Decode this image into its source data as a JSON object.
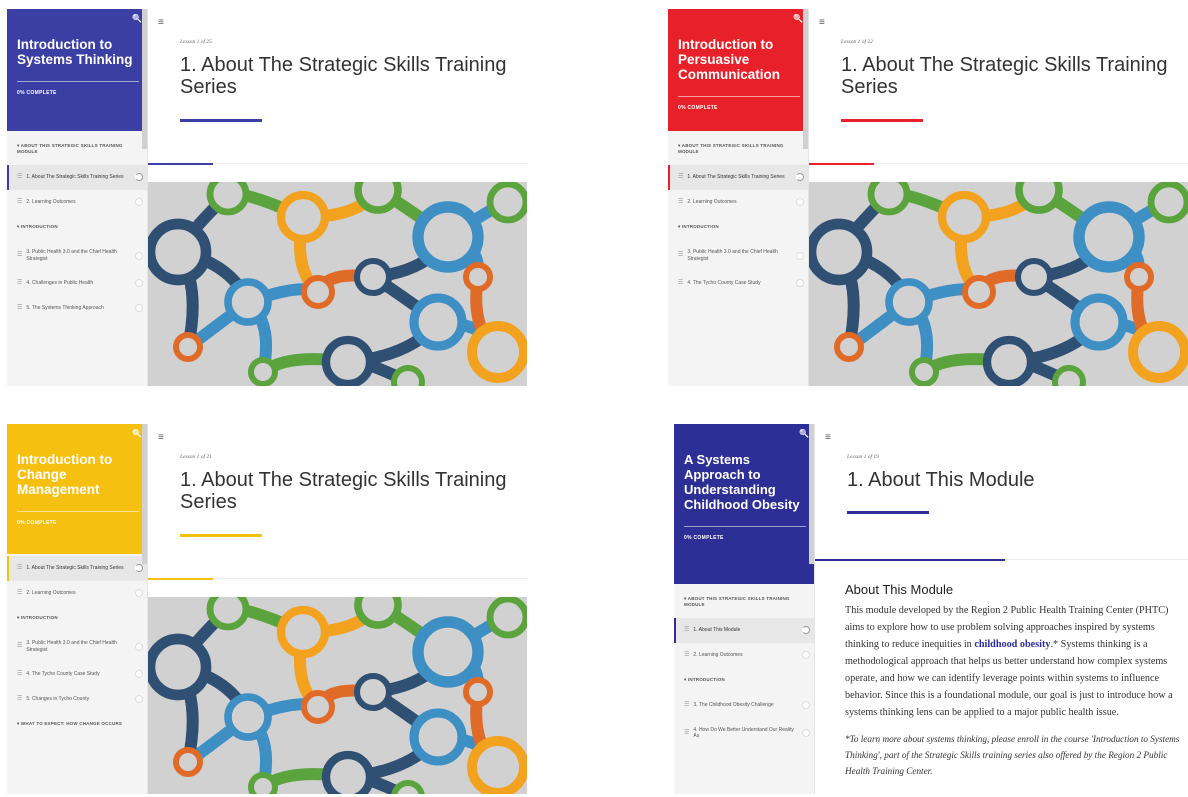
{
  "panels": [
    {
      "accent": "#3b3fa4",
      "course_title": "Introduction to Systems Thinking",
      "complete_label": "0% COMPLETE",
      "sections": [
        {
          "label": "ABOUT THIS STRATEGIC SKILLS TRAINING MODULE",
          "items": [
            {
              "label": "1. About The Strategic Skills Training Series",
              "active": true
            },
            {
              "label": "2. Learning Outcomes",
              "active": false
            }
          ]
        },
        {
          "label": "INTRODUCTION",
          "items": [
            {
              "label": "3. Public Health 3.0 and the Chief Health Strategist",
              "active": false
            },
            {
              "label": "4. Challenges in Public Health",
              "active": false
            },
            {
              "label": "5. The Systems Thinking Approach",
              "active": false
            }
          ]
        }
      ],
      "lesson_number": "Lesson 1 of 25",
      "lesson_title": "1. About The Strategic Skills Training Series"
    },
    {
      "accent": "#e8202a",
      "course_title": "Introduction to Persuasive Communication",
      "complete_label": "0% COMPLETE",
      "sections": [
        {
          "label": "ABOUT THIS STRATEGIC SKILLS TRAINING MODULE",
          "items": [
            {
              "label": "1. About The Strategic Skills Training Series",
              "active": true
            },
            {
              "label": "2. Learning Outcomes",
              "active": false
            }
          ]
        },
        {
          "label": "INTRODUCTION",
          "items": [
            {
              "label": "3. Public Health 3.0 and the Chief Health Strategist",
              "active": false
            },
            {
              "label": "4. The Tycho County Case Study",
              "active": false
            }
          ]
        }
      ],
      "lesson_number": "Lesson 1 of 22",
      "lesson_title": "1. About The Strategic Skills Training Series"
    },
    {
      "accent": "#f5c00f",
      "course_title": "Introduction to Change Management",
      "complete_label": "0% COMPLETE",
      "sections": [
        {
          "label": "",
          "items": [
            {
              "label": "1. About The Strategic Skills Training Series",
              "active": true
            },
            {
              "label": "2. Learning Outcomes",
              "active": false
            }
          ]
        },
        {
          "label": "INTRODUCTION",
          "items": [
            {
              "label": "3. Public Health 3.0 and the Chief Health Strategist",
              "active": false
            },
            {
              "label": "4. The Tycho County Case Study",
              "active": false
            },
            {
              "label": "5. Changes in Tycho County",
              "active": false
            }
          ]
        },
        {
          "label": "WHAT TO EXPECT: HOW CHANGE OCCURS",
          "items": []
        }
      ],
      "lesson_number": "Lesson 1 of 21",
      "lesson_title": "1. About The Strategic Skills Training Series"
    },
    {
      "accent": "#2e2f96",
      "course_title": "A Systems Approach to Understanding Childhood Obesity",
      "complete_label": "0% COMPLETE",
      "sections": [
        {
          "label": "ABOUT THIS STRATEGIC SKILLS TRAINING MODULE",
          "items": [
            {
              "label": "1. About This Module",
              "active": true
            },
            {
              "label": "2. Learning Outcomes",
              "active": false
            }
          ]
        },
        {
          "label": "INTRODUCTION",
          "items": [
            {
              "label": "3. The Childhood Obesity Challenge",
              "active": false
            },
            {
              "label": "4. How Do We Better Understand Our Reality As",
              "active": false
            }
          ]
        }
      ],
      "lesson_number": "Lesson 1 of 19",
      "lesson_title": "1. About This Module",
      "content": {
        "heading": "About This Module",
        "p_before": "This module developed by the Region 2 Public Health Training Center (PHTC) aims to explore how to use problem solving approaches inspired by systems thinking  to reduce inequities in ",
        "link": "childhood obesity",
        "p_after": ".* Systems thinking is a methodological approach that helps us better understand how complex systems operate, and how we can identify leverage points within systems to influence behavior. Since this is a foundational module, our goal is just to introduce how a systems thinking lens can be applied to a major public health issue.",
        "note": "*To learn more about systems thinking, please enroll in the course 'Introduction to Systems Thinking', part of the Strategic Skills training series also offered by the Region 2 Public Health Training Center."
      }
    }
  ],
  "icons": {
    "search": "search-icon",
    "menu": "hamburger-menu-icon",
    "lesson": "lesson-lines-icon",
    "status": "status-circle-icon"
  },
  "art_colors": [
    "#2f4f73",
    "#3d8fc4",
    "#5ba33c",
    "#e06b28",
    "#f2a21f",
    "#d1d1d1"
  ]
}
